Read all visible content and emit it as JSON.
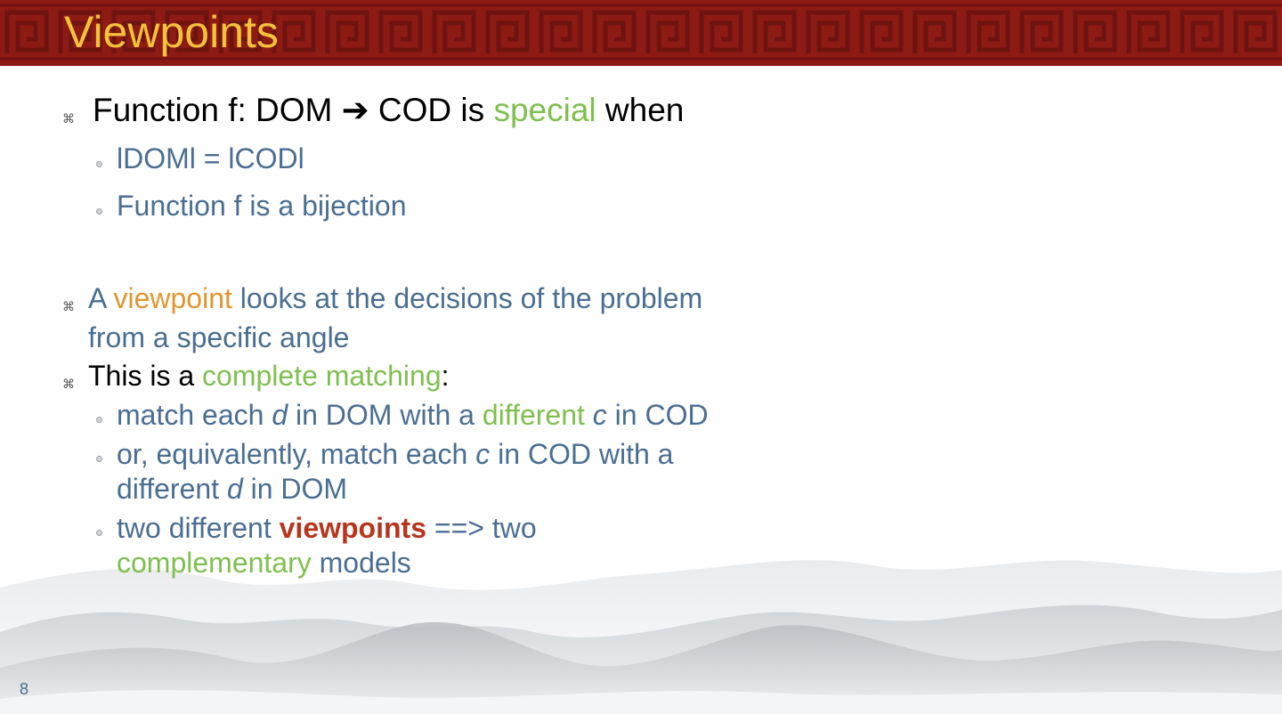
{
  "slide": {
    "title": "Viewpoints",
    "page_number": "8",
    "bullet1": {
      "t1": "Function f: DOM ",
      "arrow": "➔",
      "t2": " COD is ",
      "special": "special",
      "t3": " when",
      "sub1": "lDOMl = lCODl",
      "sub2": "Function f is a bijection"
    },
    "bullet2": {
      "t1": "A ",
      "viewpoint": "viewpoint",
      "t2": " looks at the decisions of the problem",
      "t3": "from a specific angle"
    },
    "bullet3": {
      "t1": "This is a ",
      "complete": "complete matching",
      "t2": ":",
      "sub1": {
        "a": "match each ",
        "d": "d",
        "b": " in DOM with a ",
        "different": "different",
        "space": " ",
        "c": "c",
        "e": " in COD"
      },
      "sub2": {
        "a": "or, equivalently, match each ",
        "c": "c",
        "b": " in COD with a",
        "line2a": "different ",
        "d": "d",
        "line2b": " in DOM"
      },
      "sub3": {
        "a": "two different ",
        "viewpoints": "viewpoints",
        "b": " ==> two",
        "complementary": "complementary",
        "c": " models"
      }
    }
  },
  "colors": {
    "title_bar": "#8e1a14",
    "title_text": "#f3c23a",
    "blue_text": "#4a6e92",
    "green_text": "#7fbf4f",
    "orange_text": "#e0952e",
    "red_text": "#b8351c"
  }
}
